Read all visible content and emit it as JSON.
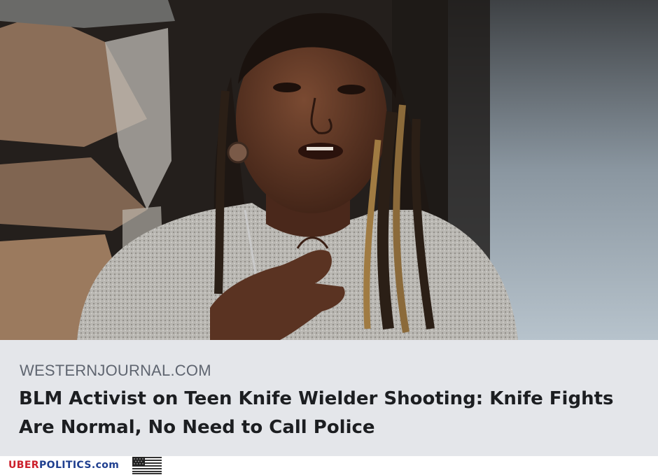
{
  "link_preview": {
    "image_icon": "photo-of-woman-speaking",
    "domain": "WESTERNJOURNAL.COM",
    "headline": "BLM Activist on Teen Knife Wielder Shooting: Knife Fights Are Normal, No Need to Call Police"
  },
  "watermark": {
    "part_uber": "UBER",
    "part_politics": "POLITICS",
    "part_com": ".com",
    "flag_icon": "us-flag-icon"
  },
  "colors": {
    "meta_background": "#e4e6ea",
    "domain_text": "#5f6570",
    "headline_text": "#1c1e21",
    "brand_red": "#cc1f2b",
    "brand_blue": "#1f3f8f"
  }
}
